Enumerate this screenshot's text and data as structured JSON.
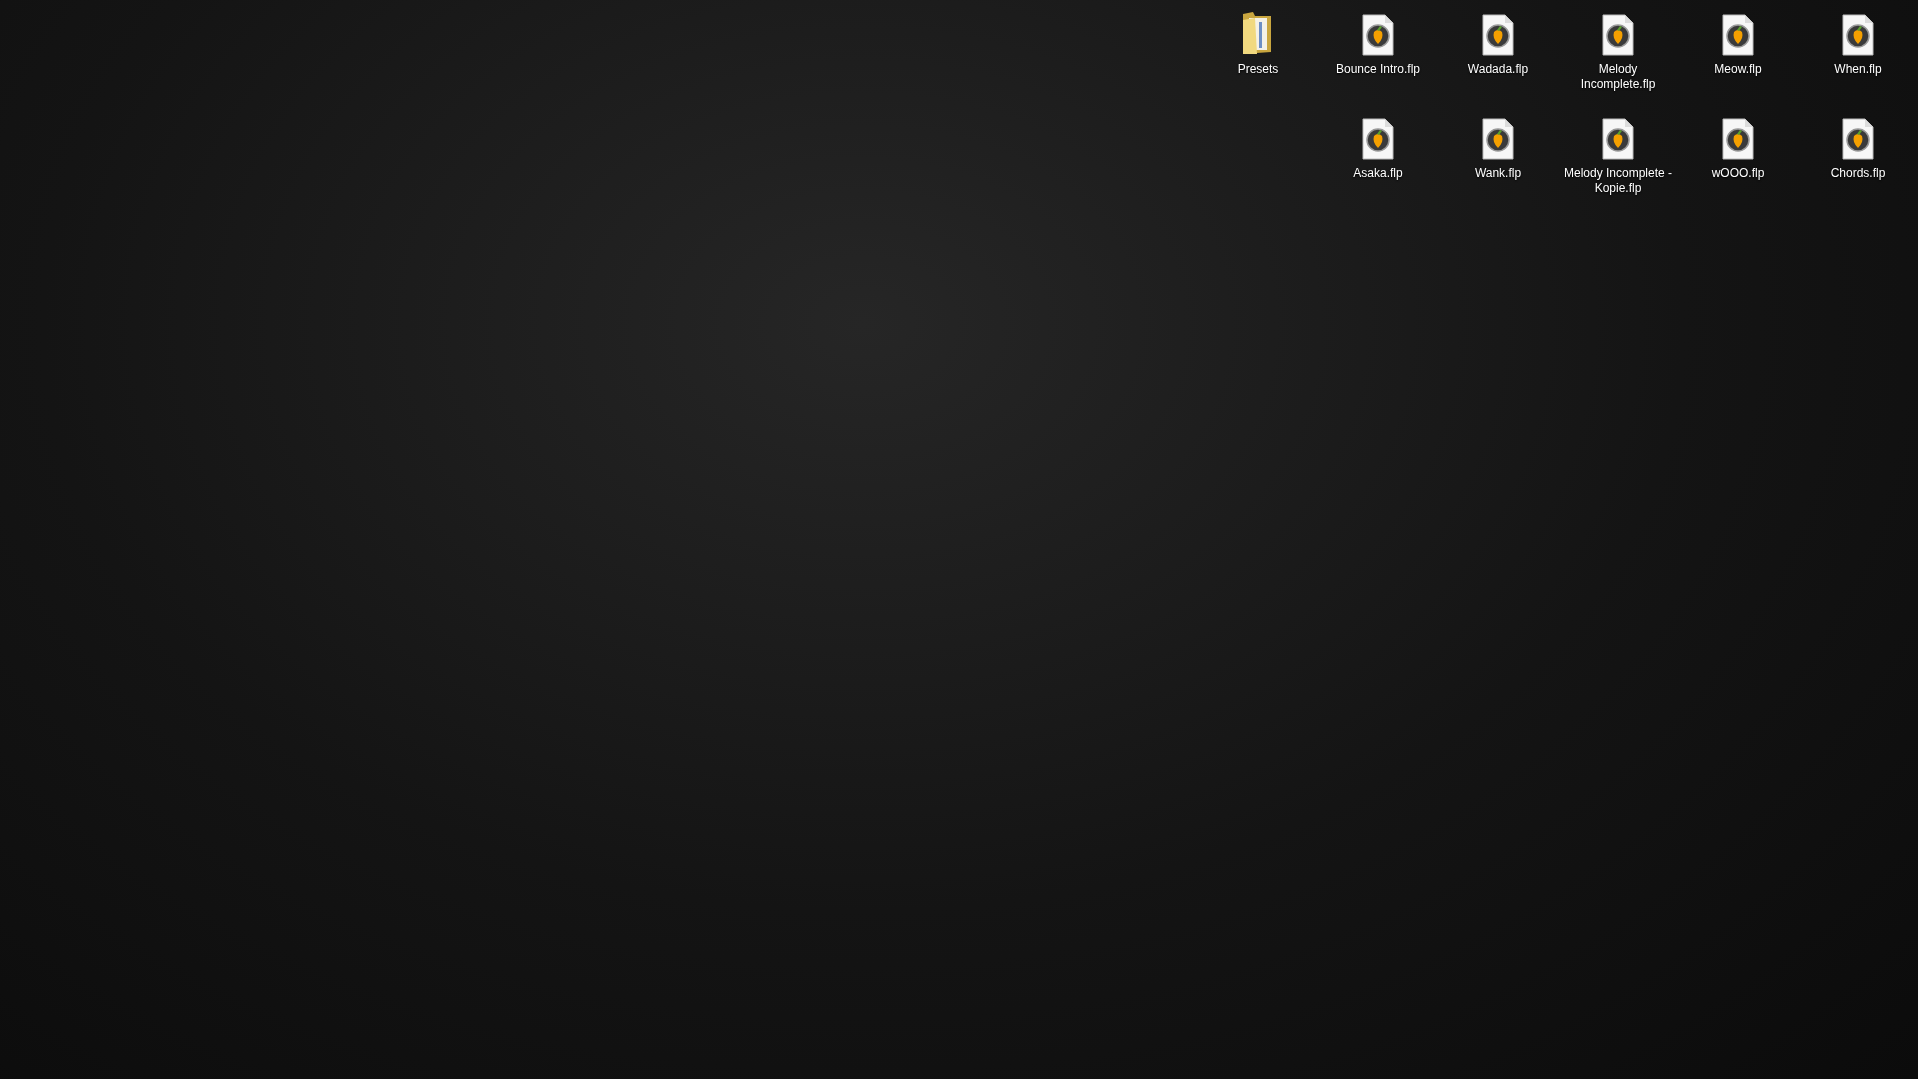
{
  "desktop": {
    "columns": [
      [
        {
          "kind": "folder",
          "label": "Presets"
        }
      ],
      [
        {
          "kind": "file",
          "label": "Bounce Intro.flp"
        },
        {
          "kind": "file",
          "label": "Asaka.flp"
        }
      ],
      [
        {
          "kind": "file",
          "label": "Wadada.flp"
        },
        {
          "kind": "file",
          "label": "Wank.flp"
        }
      ],
      [
        {
          "kind": "file",
          "label": "Melody Incomplete.flp"
        },
        {
          "kind": "file",
          "label": "Melody Incomplete - Kopie.flp"
        }
      ],
      [
        {
          "kind": "file",
          "label": "Meow.flp"
        },
        {
          "kind": "file",
          "label": "wOOO.flp"
        }
      ],
      [
        {
          "kind": "file",
          "label": "When.flp"
        },
        {
          "kind": "file",
          "label": "Chords.flp"
        }
      ]
    ]
  }
}
